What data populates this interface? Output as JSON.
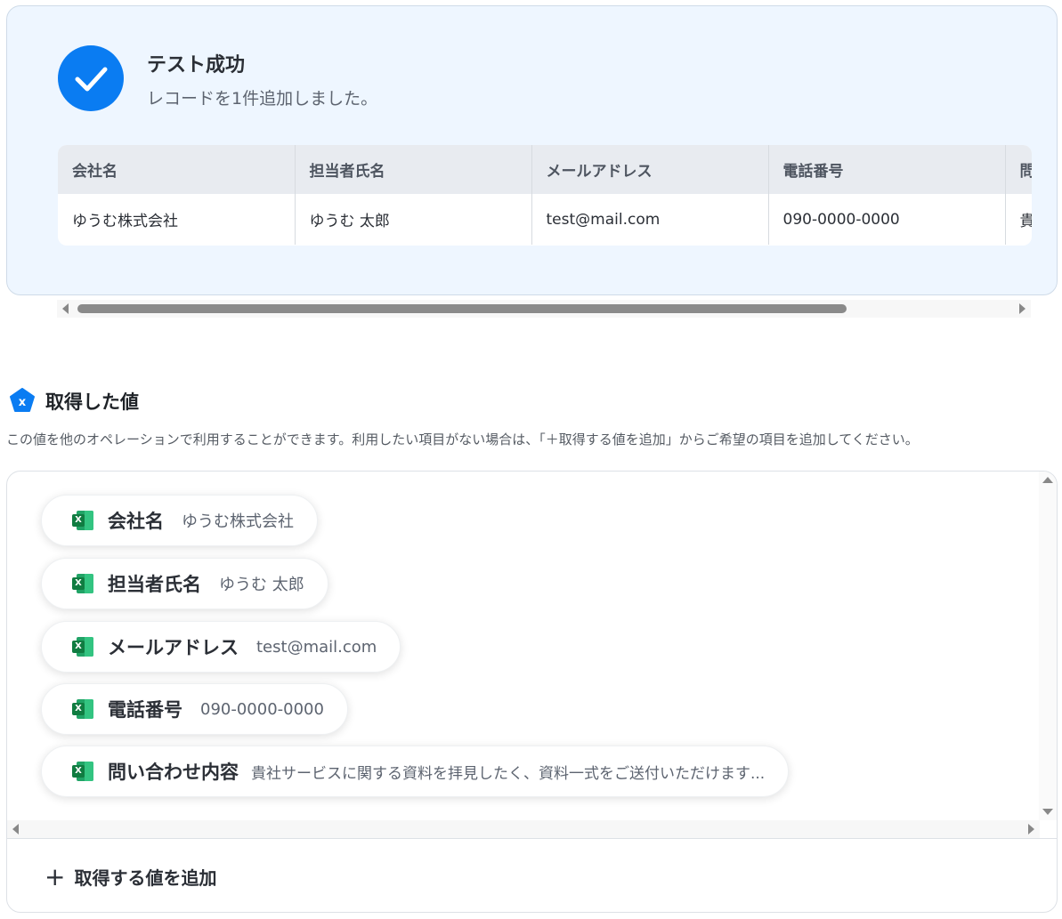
{
  "result": {
    "title": "テスト成功",
    "message": "レコードを1件追加しました。",
    "columns": [
      "会社名",
      "担当者氏名",
      "メールアドレス",
      "電話番号",
      "問い合わせ内容"
    ],
    "row": [
      "ゆうむ株式会社",
      "ゆうむ 太郎",
      "test@mail.com",
      "090-0000-0000",
      "貴社サービスに関する資料を拝見したく、資料一式をご送付いただけます..."
    ]
  },
  "section": {
    "title": "取得した値",
    "description": "この値を他のオペレーションで利用することができます。利用したい項目がない場合は、「＋取得する値を追加」からご希望の項目を追加してください。"
  },
  "values": [
    {
      "key": "会社名",
      "value": "ゆうむ株式会社"
    },
    {
      "key": "担当者氏名",
      "value": "ゆうむ 太郎"
    },
    {
      "key": "メールアドレス",
      "value": "test@mail.com"
    },
    {
      "key": "電話番号",
      "value": "090-0000-0000"
    },
    {
      "key": "問い合わせ内容",
      "value": "貴社サービスに関する資料を拝見したく、資料一式をご送付いただけます..."
    }
  ],
  "add_button": {
    "plus": "+",
    "label": "取得する値を追加"
  },
  "icons": {
    "excel_letter": "X",
    "section_letter": "x"
  }
}
